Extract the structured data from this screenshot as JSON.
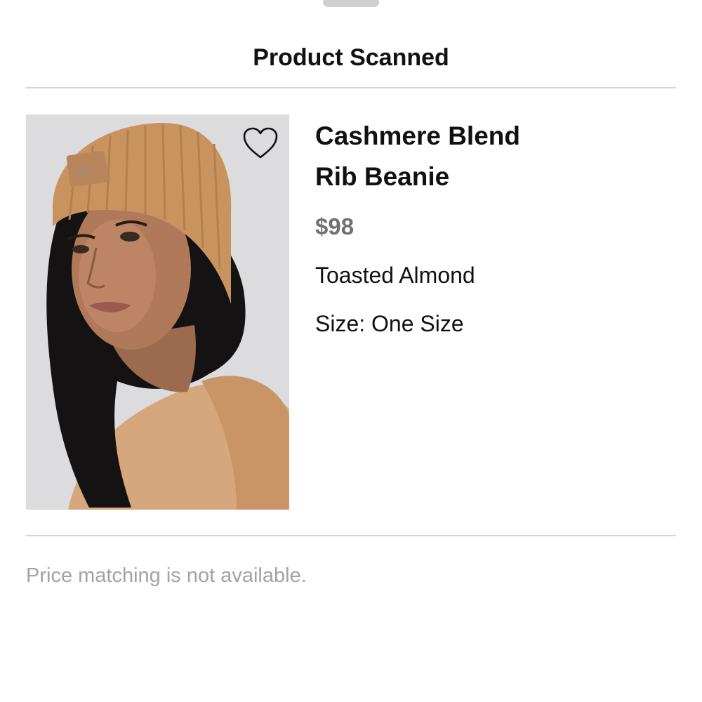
{
  "sheet": {
    "title": "Product Scanned"
  },
  "product": {
    "name": "Cashmere Blend\nRib Beanie",
    "price": "$98",
    "color": "Toasted Almond",
    "size_prefix": "Size: ",
    "size_value": "One Size",
    "image_icon": "product-photo",
    "favorite_icon": "heart-outline-icon"
  },
  "notice": {
    "text": "Price matching is not available."
  },
  "colors": {
    "background": "#ffffff",
    "title_text": "#111111",
    "price_text": "#707070",
    "notice_text": "#a3a3a3",
    "divider": "#d3d3d3"
  }
}
